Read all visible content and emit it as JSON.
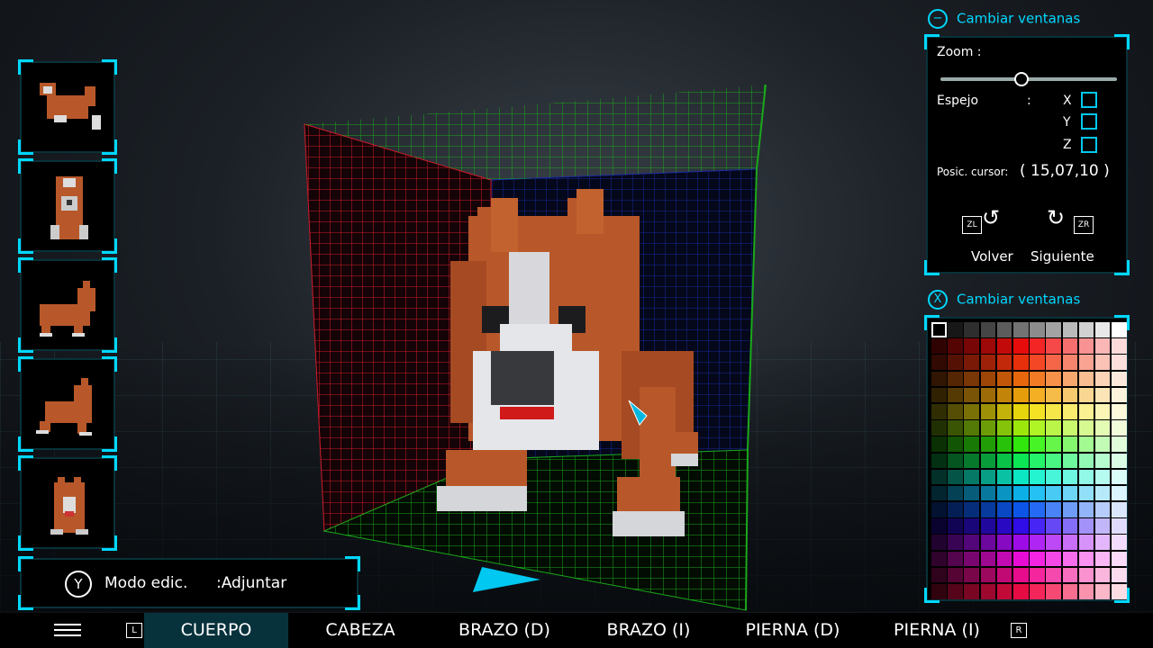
{
  "thumbnails": [
    {
      "name": "top-view"
    },
    {
      "name": "front-view"
    },
    {
      "name": "side-view"
    },
    {
      "name": "side-view-alt"
    },
    {
      "name": "back-view"
    }
  ],
  "mode_panel": {
    "button": "Y",
    "label": "Modo edic.",
    "value": ":Adjuntar"
  },
  "top_panel": {
    "header_button": "−",
    "header_label": "Cambiar ventanas",
    "zoom_label": "Zoom :",
    "zoom_level": 0.45,
    "mirror_label": "Espejo",
    "mirror_colon": ":",
    "mirror_axes": [
      "X",
      "Y",
      "Z"
    ],
    "cursor_label": "Posic. cursor:",
    "cursor_value": "( 15,07,10 )",
    "undo_button": "ZL",
    "redo_button": "ZR",
    "undo_label": "Volver",
    "redo_label": "Siguiente"
  },
  "palette_panel": {
    "header_button": "X",
    "header_label": "Cambiar ventanas"
  },
  "tabs": {
    "left_shoulder": "L",
    "right_shoulder": "R",
    "items": [
      "CUERPO",
      "CABEZA",
      "BRAZO (D)",
      "BRAZO (I)",
      "PIERNA (D)",
      "PIERNA (I)"
    ],
    "active": "CUERPO"
  },
  "colors": {
    "accent": "#00d8ff",
    "grid_red": "#d01a2a",
    "grid_blue": "#1a2aa8",
    "grid_green": "#1aa81a",
    "fur": "#b8582a",
    "white": "#e4e6ea"
  }
}
